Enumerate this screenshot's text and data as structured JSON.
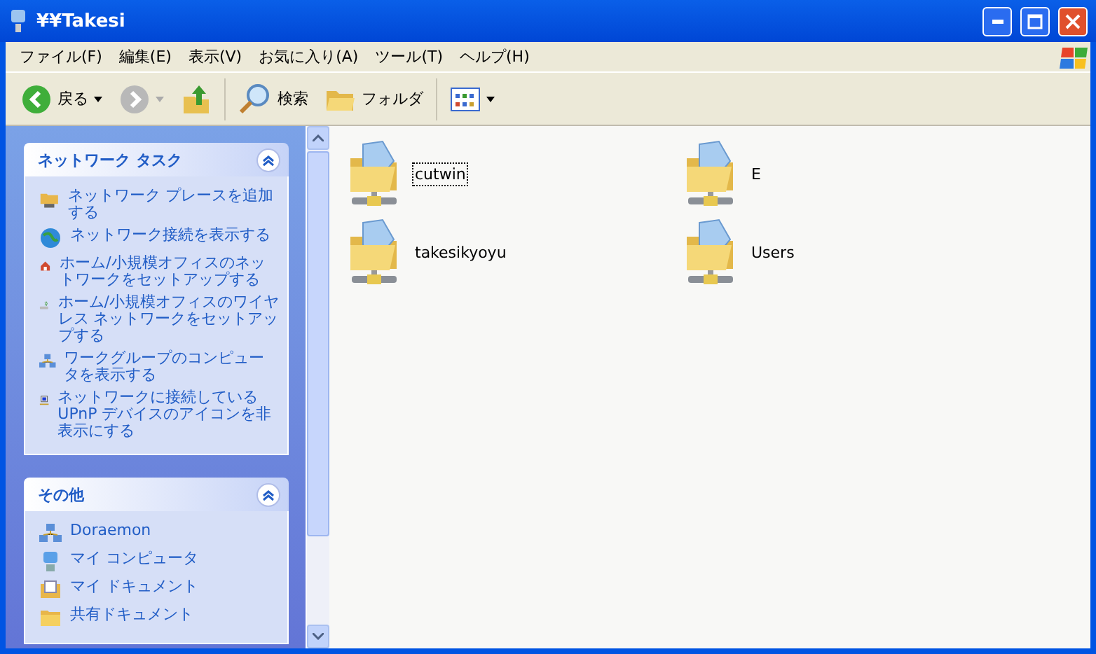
{
  "window": {
    "title": "¥¥Takesi"
  },
  "menu": [
    "ファイル(F)",
    "編集(E)",
    "表示(V)",
    "お気に入り(A)",
    "ツール(T)",
    "ヘルプ(H)"
  ],
  "toolbar": {
    "back": "戻る",
    "search": "検索",
    "folders": "フォルダ"
  },
  "panels": [
    {
      "title": "ネットワーク タスク",
      "expanded": true,
      "items": [
        {
          "kind": "add-place",
          "label": "ネットワーク プレースを追加する"
        },
        {
          "kind": "globe",
          "label": "ネットワーク接続を表示する"
        },
        {
          "kind": "home",
          "label": "ホーム/小規模オフィスのネットワークをセットアップする"
        },
        {
          "kind": "wireless",
          "label": "ホーム/小規模オフィスのワイヤレス ネットワークをセットアップする"
        },
        {
          "kind": "workgroup",
          "label": "ワークグループのコンピュータを表示する"
        },
        {
          "kind": "upnp",
          "label": "ネットワークに接続している UPnP デバイスのアイコンを非表示にする"
        }
      ]
    },
    {
      "title": "その他",
      "expanded": true,
      "items": [
        {
          "kind": "workgroup",
          "label": "Doraemon"
        },
        {
          "kind": "computer",
          "label": "マイ コンピュータ"
        },
        {
          "kind": "documents",
          "label": "マイ ドキュメント"
        },
        {
          "kind": "folder",
          "label": "共有ドキュメント"
        }
      ]
    }
  ],
  "shares": [
    {
      "name": "cutwin",
      "selected": true
    },
    {
      "name": "E",
      "selected": false
    },
    {
      "name": "takesikyoyu",
      "selected": false
    },
    {
      "name": "Users",
      "selected": false
    }
  ]
}
